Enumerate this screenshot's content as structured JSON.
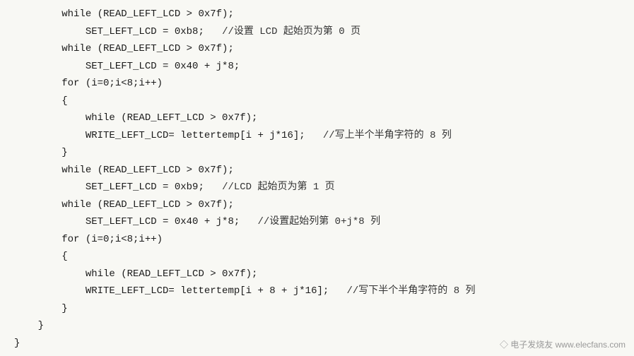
{
  "code": {
    "lines": [
      {
        "indent": 2,
        "text": "while (READ_LEFT_LCD > 0x7f);"
      },
      {
        "indent": 3,
        "text": "SET_LEFT_LCD = 0xb8;",
        "comment": "//设置 LCD 起始页为第 0 页"
      },
      {
        "indent": 2,
        "text": "while (READ_LEFT_LCD > 0x7f);"
      },
      {
        "indent": 3,
        "text": "SET_LEFT_LCD = 0x40 + j*8;"
      },
      {
        "indent": 2,
        "text": "for (i=0;i<8;i++)"
      },
      {
        "indent": 2,
        "text": "{"
      },
      {
        "indent": 3,
        "text": "while (READ_LEFT_LCD > 0x7f);"
      },
      {
        "indent": 3,
        "text": "WRITE_LEFT_LCD= lettertemp[i + j*16];",
        "comment": "//写上半个半角字符的 8 列"
      },
      {
        "indent": 2,
        "text": "}"
      },
      {
        "indent": 2,
        "text": "while (READ_LEFT_LCD > 0x7f);"
      },
      {
        "indent": 3,
        "text": "SET_LEFT_LCD = 0xb9;",
        "comment": "//LCD 起始页为第 1 页"
      },
      {
        "indent": 2,
        "text": "while (READ_LEFT_LCD > 0x7f);"
      },
      {
        "indent": 3,
        "text": "SET_LEFT_LCD = 0x40 + j*8;",
        "comment": "//设置起始列第 0+j*8 列"
      },
      {
        "indent": 2,
        "text": "for (i=0;i<8;i++)"
      },
      {
        "indent": 2,
        "text": "{"
      },
      {
        "indent": 3,
        "text": "while (READ_LEFT_LCD > 0x7f);"
      },
      {
        "indent": 3,
        "text": "WRITE_LEFT_LCD= lettertemp[i + 8 + j*16];",
        "comment": "//写下半个半角字符的 8 列"
      },
      {
        "indent": 2,
        "text": "}"
      },
      {
        "indent": 1,
        "text": "}"
      },
      {
        "indent": 0,
        "text": "}"
      }
    ],
    "indent_unit": "    ",
    "watermark": "◇ 电子发烧友 www.elecfans.com"
  }
}
